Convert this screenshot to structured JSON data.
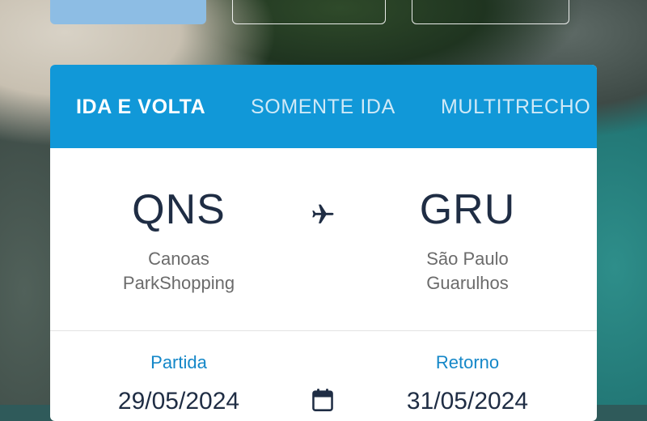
{
  "tabs": [
    {
      "label": "IDA E VOLTA",
      "active": true
    },
    {
      "label": "SOMENTE IDA",
      "active": false
    },
    {
      "label": "MULTITRECHO",
      "active": false
    }
  ],
  "origin": {
    "code": "QNS",
    "city_line1": "Canoas",
    "city_line2": "ParkShopping"
  },
  "destination": {
    "code": "GRU",
    "city_line1": "São Paulo",
    "city_line2": "Guarulhos"
  },
  "dates": {
    "departure_label": "Partida",
    "departure_value": "29/05/2024",
    "return_label": "Retorno",
    "return_value": "31/05/2024"
  },
  "icons": {
    "route": "airplane-icon",
    "date": "calendar-icon"
  },
  "colors": {
    "accent": "#1198d8",
    "text_dark": "#1f2d44",
    "label_blue": "#1487c8"
  }
}
